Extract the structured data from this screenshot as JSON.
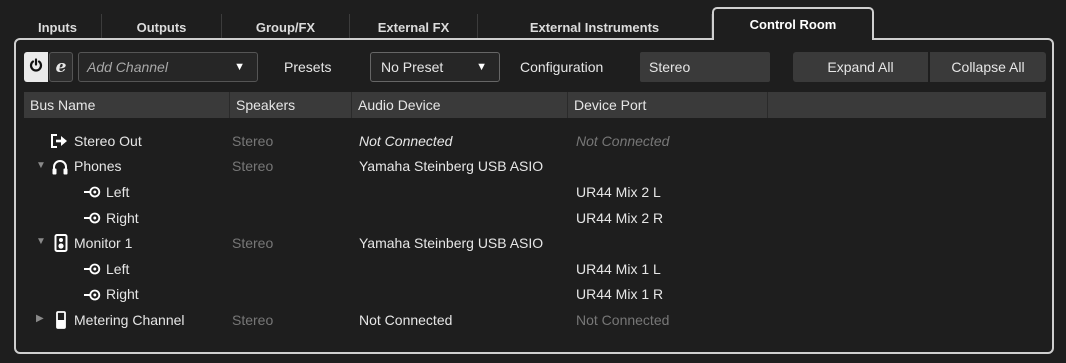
{
  "tabs": [
    {
      "label": "Inputs"
    },
    {
      "label": "Outputs"
    },
    {
      "label": "Group/FX"
    },
    {
      "label": "External FX"
    },
    {
      "label": "External Instruments"
    },
    {
      "label": "Control Room",
      "active": true
    }
  ],
  "toolbar": {
    "add_channel_placeholder": "Add Channel",
    "presets_label": "Presets",
    "preset_value": "No Preset",
    "configuration_label": "Configuration",
    "configuration_value": "Stereo",
    "expand_all": "Expand All",
    "collapse_all": "Collapse All"
  },
  "table": {
    "columns": [
      "Bus Name",
      "Speakers",
      "Audio Device",
      "Device Port"
    ],
    "rows": [
      {
        "name": "Stereo Out",
        "icon": "output-arrow-icon",
        "level": 0,
        "expander": "",
        "speakers": "Stereo",
        "device": "Not Connected",
        "port": "Not Connected"
      },
      {
        "name": "Phones",
        "icon": "headphones-icon",
        "level": 0,
        "expander": "▼",
        "speakers": "Stereo",
        "device": "Yamaha Steinberg USB ASIO",
        "port": ""
      },
      {
        "name": "Left",
        "icon": "port-connector-icon",
        "level": 1,
        "expander": "",
        "speakers": "",
        "device": "",
        "port": "UR44 Mix 2 L"
      },
      {
        "name": "Right",
        "icon": "port-connector-icon",
        "level": 1,
        "expander": "",
        "speakers": "",
        "device": "",
        "port": "UR44 Mix 2 R"
      },
      {
        "name": "Monitor 1",
        "icon": "speaker-icon",
        "level": 0,
        "expander": "▼",
        "speakers": "Stereo",
        "device": "Yamaha Steinberg USB ASIO",
        "port": ""
      },
      {
        "name": "Left",
        "icon": "port-connector-icon",
        "level": 1,
        "expander": "",
        "speakers": "",
        "device": "",
        "port": "UR44 Mix 1 L"
      },
      {
        "name": "Right",
        "icon": "port-connector-icon",
        "level": 1,
        "expander": "",
        "speakers": "",
        "device": "",
        "port": "UR44 Mix 1 R"
      },
      {
        "name": "Metering Channel",
        "icon": "meter-icon",
        "level": 0,
        "expander": "▶",
        "speakers": "Stereo",
        "device": "Not Connected",
        "port": "Not Connected"
      }
    ]
  },
  "colors": {
    "background": "#1e1e1e",
    "control": "#3a3a3a",
    "highlight": "#cfcfcf",
    "dim_text": "#777777"
  }
}
